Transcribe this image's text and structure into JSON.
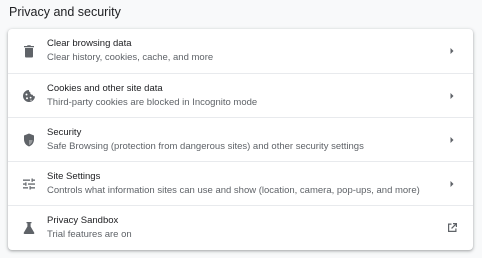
{
  "section": {
    "title": "Privacy and security"
  },
  "rows": [
    {
      "label": "Clear browsing data",
      "sub": "Clear history, cookies, cache, and more",
      "icon": "trash-icon",
      "action": "chevron-right-icon"
    },
    {
      "label": "Cookies and other site data",
      "sub": "Third-party cookies are blocked in Incognito mode",
      "icon": "cookie-icon",
      "action": "chevron-right-icon"
    },
    {
      "label": "Security",
      "sub": "Safe Browsing (protection from dangerous sites) and other security settings",
      "icon": "shield-icon",
      "action": "chevron-right-icon"
    },
    {
      "label": "Site Settings",
      "sub": "Controls what information sites can use and show (location, camera, pop-ups, and more)",
      "icon": "tune-icon",
      "action": "chevron-right-icon"
    },
    {
      "label": "Privacy Sandbox",
      "sub": "Trial features are on",
      "icon": "flask-icon",
      "action": "open-in-new-icon"
    }
  ],
  "colors": {
    "text_primary": "#202124",
    "text_secondary": "#5f6368",
    "icon": "#5f6368",
    "divider": "#e8eaed",
    "background": "#f8f9fa",
    "card": "#ffffff"
  }
}
